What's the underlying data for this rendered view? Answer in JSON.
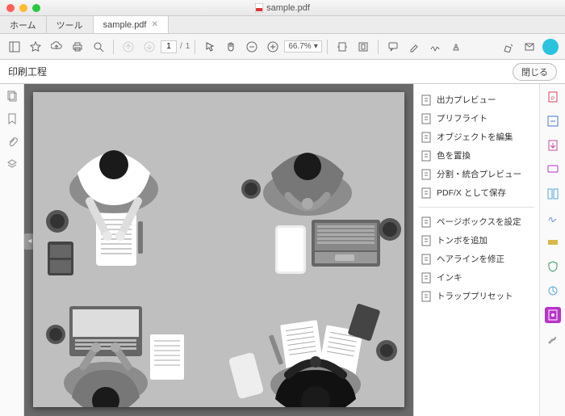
{
  "window": {
    "title": "sample.pdf"
  },
  "tabs": {
    "home": "ホーム",
    "tools": "ツール",
    "doc": "sample.pdf"
  },
  "toolbar": {
    "page_current": "1",
    "page_sep": "/",
    "page_total": "1",
    "zoom_value": "66.7%"
  },
  "subheader": {
    "title": "印刷工程",
    "close": "閉じる"
  },
  "panel": {
    "group1": [
      "出力プレビュー",
      "プリフライト",
      "オブジェクトを編集",
      "色を置換",
      "分割・統合プレビュー",
      "PDF/X として保存"
    ],
    "group2": [
      "ページボックスを設定",
      "トンボを追加",
      "ヘアラインを修正",
      "インキ",
      "トラッププリセット"
    ]
  }
}
